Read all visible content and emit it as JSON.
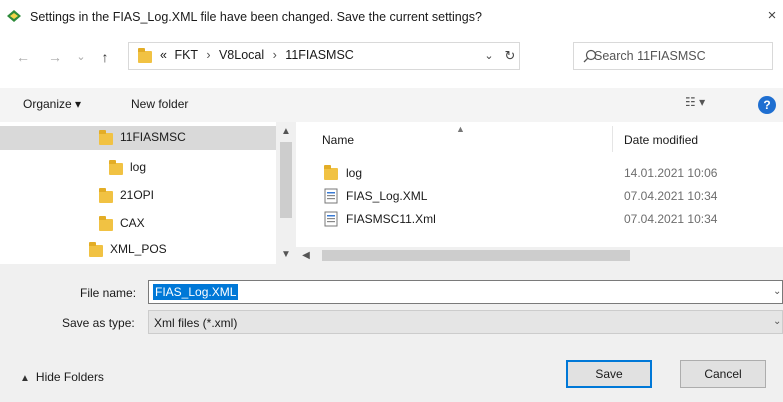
{
  "window": {
    "title": "Settings in the FIAS_Log.XML file have been changed. Save the current settings?",
    "close_icon": "×"
  },
  "nav": {
    "back": "←",
    "forward": "→",
    "recent": "⌄",
    "up": "↑"
  },
  "address": {
    "overflow": "«",
    "crumbs": [
      "FKT",
      "V8Local",
      "11FIASMSC"
    ],
    "separator": "›",
    "dropdown": "⌄",
    "refresh": "↻"
  },
  "search": {
    "placeholder": "Search 11FIASMSC"
  },
  "toolbar": {
    "organize_label": "Organize ▾",
    "new_folder_label": "New folder",
    "view_label": "☷ ▾",
    "help_label": "?"
  },
  "tree": {
    "items": [
      {
        "label": "11FIASMSC",
        "selected": true
      },
      {
        "label": "log",
        "selected": false
      },
      {
        "label": "21OPI",
        "selected": false
      },
      {
        "label": "CAX",
        "selected": false
      },
      {
        "label": "XML_POS",
        "selected": false
      }
    ]
  },
  "list": {
    "columns": {
      "name": "Name",
      "date": "Date modified"
    },
    "rows": [
      {
        "name": "log",
        "date": "14.01.2021 10:06",
        "type": "folder"
      },
      {
        "name": "FIAS_Log.XML",
        "date": "07.04.2021 10:34",
        "type": "xml"
      },
      {
        "name": "FIASMSC11.Xml",
        "date": "07.04.2021 10:34",
        "type": "xml"
      }
    ]
  },
  "form": {
    "file_name_label": "File name:",
    "file_name_value": "FIAS_Log.XML",
    "save_as_label": "Save as type:",
    "save_as_value": "Xml files (*.xml)"
  },
  "footer": {
    "hide_folders_label": "Hide Folders",
    "save_label": "Save",
    "cancel_label": "Cancel"
  },
  "colors": {
    "accent": "#0078d7",
    "folder": "#f1c243",
    "selected_bg": "#d9d9d9"
  }
}
